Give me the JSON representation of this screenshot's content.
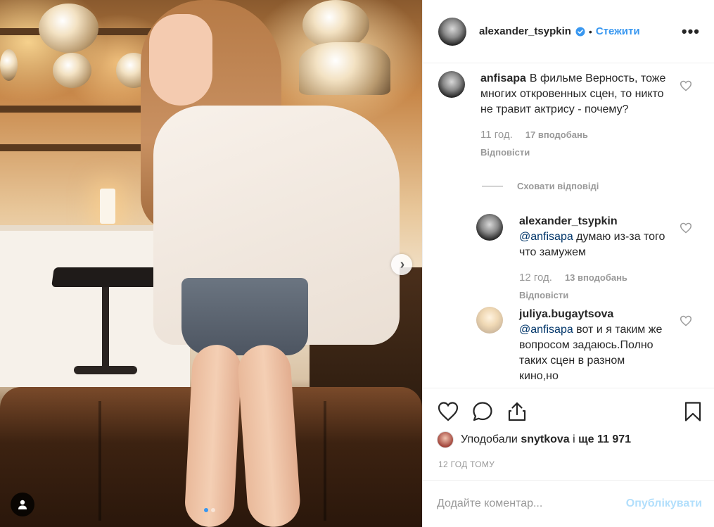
{
  "header": {
    "username": "alexander_tsypkin",
    "follow_label": "Стежити",
    "separator": "•",
    "more_label": "•••"
  },
  "comments": [
    {
      "author": "anfisapa",
      "text": "В фильме Верность, тоже многих откровенных сцен, то никто не травит актрису - почему?",
      "time": "11 год.",
      "likes": "17 вподобань",
      "reply_label": "Відповісти"
    },
    {
      "author": "alexander_tsypkin",
      "mention": "@anfisapa",
      "text": " думаю из-за того что замужем",
      "time": "12 год.",
      "likes": "13 вподобань",
      "reply_label": "Відповісти"
    },
    {
      "author": "juliya.bugaytsova",
      "mention": "@anfisapa",
      "text": " вот и я таким же вопросом задаюсь.Полно таких сцен в разном кино,но"
    }
  ],
  "hide_replies_label": "Сховати відповіді",
  "likes_summary": {
    "prefix": "Уподобали",
    "user": "snytkova",
    "connector": "і",
    "count": "ще 11 971"
  },
  "timestamp": "12 ГОД ТОМУ",
  "add_comment": {
    "placeholder": "Додайте коментар...",
    "publish_label": "Опублікувати"
  },
  "carousel": {
    "current_index": 1,
    "total": 2
  },
  "icons": {
    "verified": "verified-badge-icon",
    "heart": "heart-icon",
    "comment": "comment-icon",
    "share": "share-icon",
    "bookmark": "bookmark-icon",
    "next": "chevron-right-icon",
    "tagged_user": "user-tag-icon"
  },
  "colors": {
    "accent": "#3897f0",
    "muted": "#999999",
    "publish_disabled": "#b2dffc",
    "text": "#262626"
  }
}
